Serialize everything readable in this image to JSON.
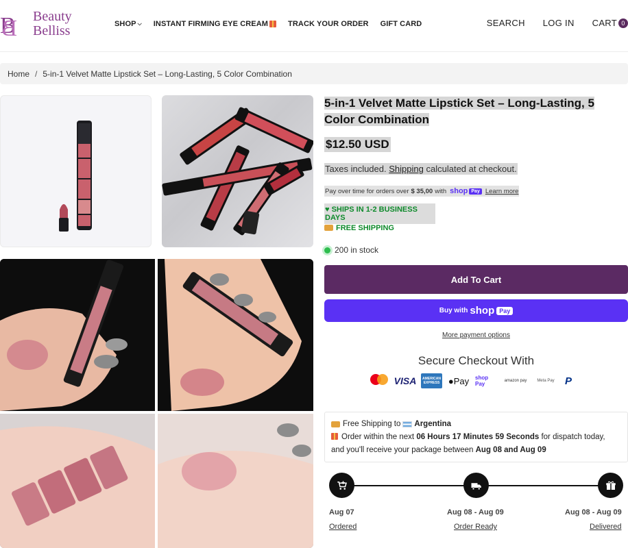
{
  "header": {
    "logo_line1": "Beauty",
    "logo_line2": "Belliss",
    "nav": {
      "shop": "SHOP",
      "eye_cream": "INSTANT FIRMING EYE CREAM",
      "track": "TRACK YOUR ORDER",
      "gift": "GIFT CARD"
    },
    "search": "SEARCH",
    "login": "LOG IN",
    "cart": "CART",
    "cart_count": "0"
  },
  "breadcrumb": {
    "home": "Home",
    "separator": "/",
    "current": "5-in-1 Velvet Matte Lipstick Set – Long-Lasting, 5 Color Combination"
  },
  "product": {
    "title": "5-in-1 Velvet Matte Lipstick Set – Long-Lasting, 5 Color Combination",
    "price": "$12.50 USD",
    "taxes_prefix": "Taxes included.",
    "shipping_link": "Shipping",
    "taxes_suffix": "calculated at checkout.",
    "payover_prefix": "Pay over time for orders over",
    "payover_amount": "$ 35,00",
    "payover_with": "with",
    "shop_word": "shop",
    "pay_word": "Pay",
    "learn_more": "Learn more",
    "ships_days": "♥ SHIPS IN 1-2 BUSINESS DAYS",
    "free_shipping": "FREE SHIPPING",
    "stock": "200 in stock"
  },
  "buttons": {
    "add_to_cart": "Add To Cart",
    "buy_with": "Buy with",
    "shop": "shop",
    "pay": "Pay",
    "more_payment": "More payment options"
  },
  "secure": {
    "title": "Secure Checkout With",
    "visa": "VISA",
    "amex": "AMERICAN EXPRESS",
    "apple_pay": "Pay",
    "shop_pay": "shop Pay",
    "amazon_pay": "amazon pay",
    "meta_pay": "Meta Pay",
    "paypal": "P"
  },
  "shipping_box": {
    "free_ship_prefix": "Free Shipping to",
    "country": "Argentina",
    "order_prefix": "Order within the next",
    "countdown": "06 Hours 17 Minutes 59 Seconds",
    "order_suffix": "for dispatch today,",
    "receive_prefix": "and you'll receive your package between",
    "dates": "Aug 08 and Aug 09"
  },
  "timeline": [
    {
      "date": "Aug 07",
      "label": "Ordered",
      "icon": "cart-icon"
    },
    {
      "date": "Aug 08 - Aug 09",
      "label": "Order Ready",
      "icon": "truck-icon"
    },
    {
      "date": "Aug 08 - Aug 09",
      "label": "Delivered",
      "icon": "gift-icon"
    }
  ],
  "colors": {
    "brand_purple": "#5b2a63",
    "shop_pay_purple": "#5a31f4",
    "ships_green": "#0e8a2b",
    "logo_purple": "#8a3e8e"
  }
}
